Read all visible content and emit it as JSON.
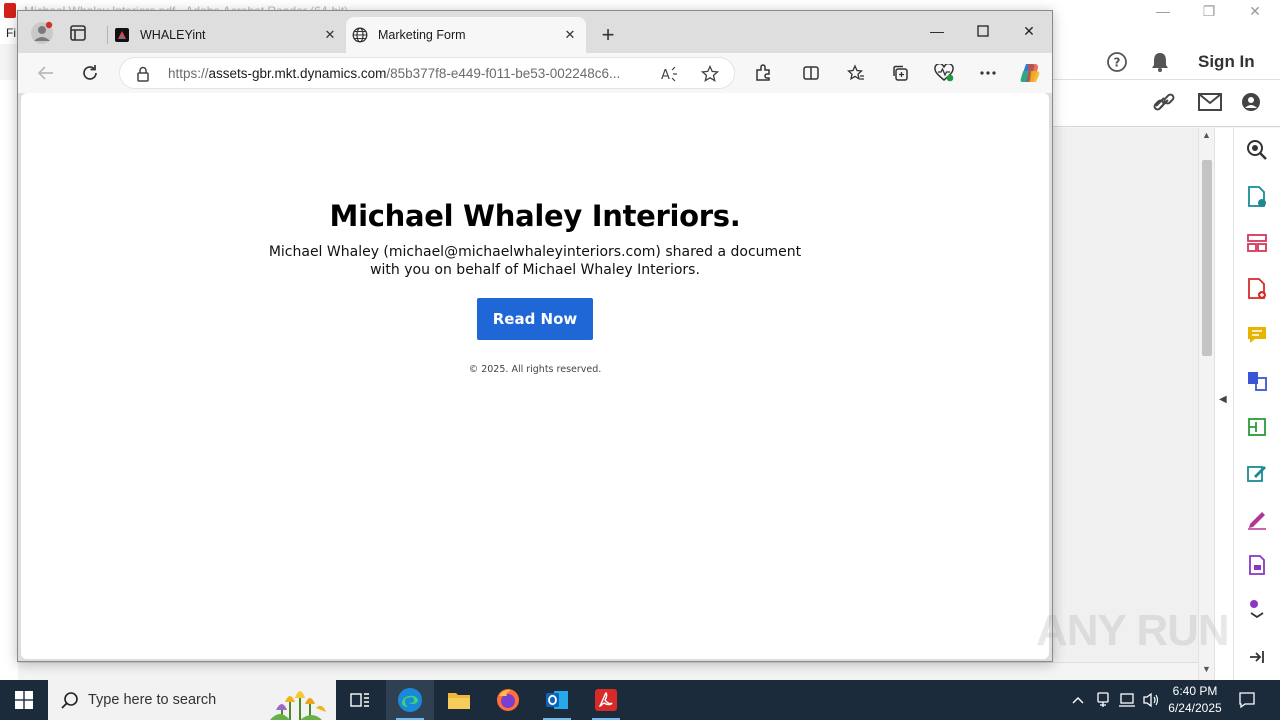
{
  "acrobat": {
    "title": "Michael Whaley Interiors.pdf - Adobe Acrobat Reader (64-bit)",
    "menu_first": "Fi",
    "sign_in": "Sign In"
  },
  "browser": {
    "tabs": [
      {
        "label": "WHALEYint",
        "favicon": "whaleyint-logo-icon"
      },
      {
        "label": "Marketing Form",
        "favicon": "globe-icon",
        "active": true
      }
    ],
    "url_prefix": "https://",
    "url_domain": "assets-gbr.mkt.dynamics.com",
    "url_path": "/85b377f8-e449-f011-be53-002248c6..."
  },
  "page": {
    "heading": "Michael Whaley Interiors.",
    "message": "Michael Whaley (michael@michaelwhaleyinteriors.com) shared a document with you on behalf of Michael Whaley Interiors.",
    "button_label": "Read Now",
    "button_color": "#1f66d6",
    "copyright": "© 2025. All rights reserved."
  },
  "taskbar": {
    "search_placeholder": "Type here to search",
    "time": "6:40 PM",
    "date": "6/24/2025"
  },
  "watermark": "ANY RUN"
}
